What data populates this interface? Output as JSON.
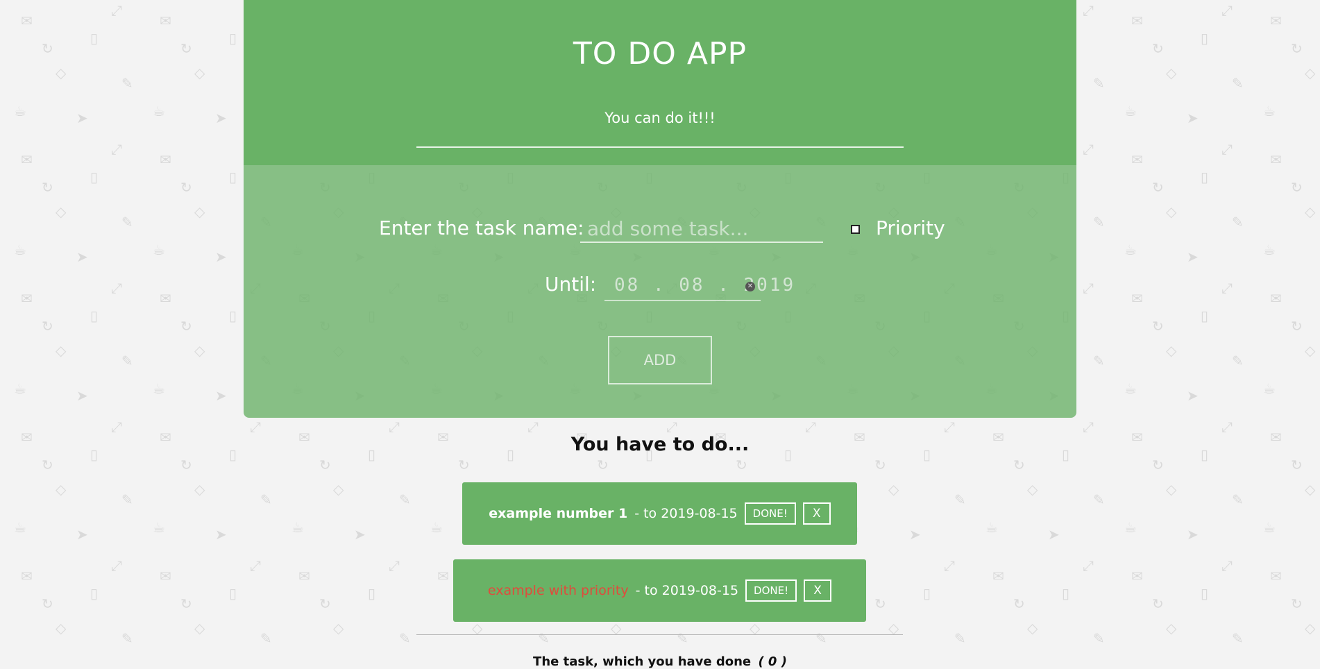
{
  "header": {
    "title": "TO DO APP",
    "subtitle": "You can do it!!!"
  },
  "form": {
    "task_label": "Enter the task name:",
    "task_placeholder": "add some task...",
    "task_value": "",
    "priority_label": "Priority",
    "priority_checked": false,
    "until_label": "Until:",
    "date_value": "08 . 08 . 2019",
    "add_label": "ADD"
  },
  "todo": {
    "heading": "You have to do...",
    "tasks": [
      {
        "name": "example number 1",
        "due": "- to 2019-08-15",
        "priority": false,
        "done_label": "DONE!",
        "delete_label": "X"
      },
      {
        "name": "example with priority",
        "due": "- to 2019-08-15",
        "priority": true,
        "done_label": "DONE!",
        "delete_label": "X"
      }
    ]
  },
  "done": {
    "heading": "The task, which you have done",
    "count": "( 0 )"
  },
  "colors": {
    "page_background": "#f3f3f3",
    "header_green": "#69b266",
    "panel_green": "#80bb7e",
    "card_green": "#69b266",
    "priority_red": "#e04b3c"
  },
  "icons": [
    "mail-icon",
    "phone-icon",
    "tag-icon",
    "pencil-icon",
    "coffee-icon",
    "plane-icon",
    "cycle-icon",
    "expand-icon"
  ]
}
